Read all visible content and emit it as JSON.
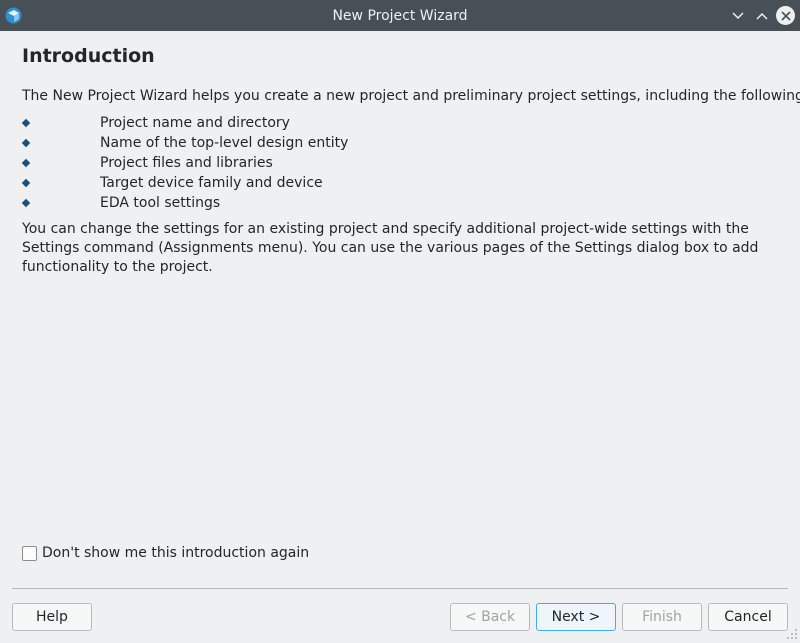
{
  "window": {
    "title": "New Project Wizard",
    "icon": "quartus-app-icon",
    "controls": [
      "chevron-down-icon",
      "chevron-up-icon",
      "close-icon"
    ]
  },
  "page": {
    "heading": "Introduction",
    "intro": "The New Project Wizard helps you create a new project and preliminary project settings, including the following:",
    "bullets": [
      "Project name and directory",
      "Name of the top-level design entity",
      "Project files and libraries",
      "Target device family and device",
      "EDA tool settings"
    ],
    "paragraph": "You can change the settings for an existing project and specify additional project-wide settings with the Settings command (Assignments menu). You can use the various pages of the Settings dialog box to add functionality to the project."
  },
  "options": {
    "dont_show_label": "Don't show me this introduction again",
    "dont_show_checked": false
  },
  "buttons": {
    "help": "Help",
    "back": "< Back",
    "next": "Next >",
    "finish": "Finish",
    "cancel": "Cancel"
  },
  "colors": {
    "titlebar": "#475057",
    "background": "#eff0f1",
    "bullet": "#1c4f78",
    "focus_accent": "#3daee9"
  }
}
